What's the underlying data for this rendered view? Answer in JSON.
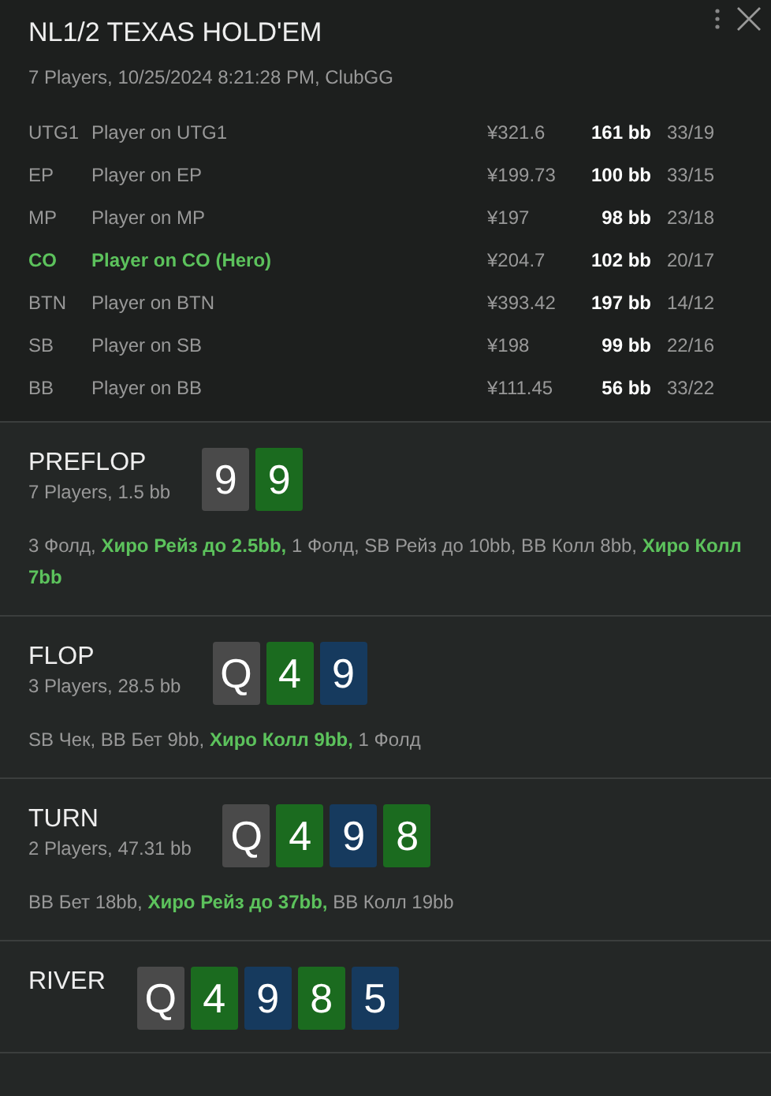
{
  "header": {
    "title": "NL1/2 TEXAS HOLD'EM",
    "subtitle": "7 Players, 10/25/2024 8:21:28 PM, ClubGG"
  },
  "players": [
    {
      "position": "UTG1",
      "name": "Player on UTG1",
      "stack": "¥321.6",
      "bb": "161 bb",
      "stats": "33/19",
      "hero": false
    },
    {
      "position": "EP",
      "name": "Player on EP",
      "stack": "¥199.73",
      "bb": "100 bb",
      "stats": "33/15",
      "hero": false
    },
    {
      "position": "MP",
      "name": "Player on MP",
      "stack": "¥197",
      "bb": "98 bb",
      "stats": "23/18",
      "hero": false
    },
    {
      "position": "CO",
      "name": "Player on CO (Hero)",
      "stack": "¥204.7",
      "bb": "102 bb",
      "stats": "20/17",
      "hero": true
    },
    {
      "position": "BTN",
      "name": "Player on BTN",
      "stack": "¥393.42",
      "bb": "197 bb",
      "stats": "14/12",
      "hero": false
    },
    {
      "position": "SB",
      "name": "Player on SB",
      "stack": "¥198",
      "bb": "99 bb",
      "stats": "22/16",
      "hero": false
    },
    {
      "position": "BB",
      "name": "Player on BB",
      "stack": "¥111.45",
      "bb": "56 bb",
      "stats": "33/22",
      "hero": false
    }
  ],
  "streets": [
    {
      "name": "PREFLOP",
      "info": "7 Players, 1.5 bb",
      "cards": [
        {
          "rank": "9",
          "color": "#4a4a4a"
        },
        {
          "rank": "9",
          "color": "#1b6b1f"
        }
      ],
      "actions": [
        {
          "text": "3 Фолд, ",
          "hero": false
        },
        {
          "text": "Хиро Рейз до 2.5bb,",
          "hero": true
        },
        {
          "text": " 1 Фолд, SB Рейз до 10bb, BB Колл 8bb, ",
          "hero": false
        },
        {
          "text": "Хиро Колл 7bb",
          "hero": true
        }
      ]
    },
    {
      "name": "FLOP",
      "info": "3 Players, 28.5 bb",
      "cards": [
        {
          "rank": "Q",
          "color": "#4a4a4a"
        },
        {
          "rank": "4",
          "color": "#1b6b1f"
        },
        {
          "rank": "9",
          "color": "#163a5e"
        }
      ],
      "actions": [
        {
          "text": "SB Чек, BB Бет 9bb, ",
          "hero": false
        },
        {
          "text": "Хиро Колл 9bb,",
          "hero": true
        },
        {
          "text": " 1 Фолд",
          "hero": false
        }
      ]
    },
    {
      "name": "TURN",
      "info": "2 Players, 47.31 bb",
      "cards": [
        {
          "rank": "Q",
          "color": "#4a4a4a"
        },
        {
          "rank": "4",
          "color": "#1b6b1f"
        },
        {
          "rank": "9",
          "color": "#163a5e"
        },
        {
          "rank": "8",
          "color": "#1b6b1f"
        }
      ],
      "actions": [
        {
          "text": "BB Бет 18bb, ",
          "hero": false
        },
        {
          "text": "Хиро Рейз до 37bb,",
          "hero": true
        },
        {
          "text": " BB Колл 19bb",
          "hero": false
        }
      ]
    },
    {
      "name": "RIVER",
      "cards": [
        {
          "rank": "Q",
          "color": "#4a4a4a"
        },
        {
          "rank": "4",
          "color": "#1b6b1f"
        },
        {
          "rank": "9",
          "color": "#163a5e"
        },
        {
          "rank": "8",
          "color": "#1b6b1f"
        },
        {
          "rank": "5",
          "color": "#163a5e"
        }
      ]
    }
  ]
}
